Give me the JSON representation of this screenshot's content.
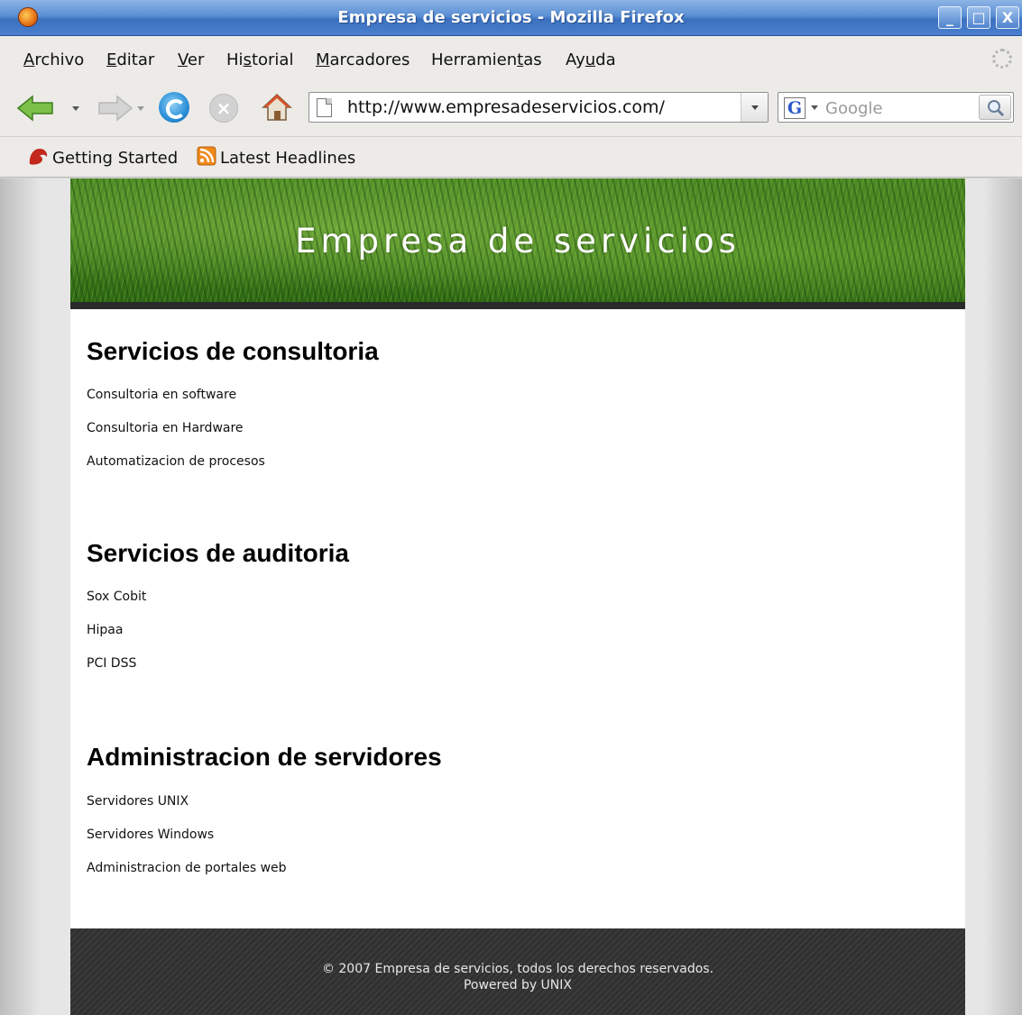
{
  "window": {
    "title": "Empresa de servicios - Mozilla Firefox",
    "buttons": {
      "minimize": "_",
      "maximize": "□",
      "close": "X"
    }
  },
  "menu": {
    "archivo": {
      "accel": "A",
      "rest": "rchivo"
    },
    "editar": {
      "accel": "E",
      "rest": "ditar"
    },
    "ver": {
      "accel": "V",
      "rest": "er"
    },
    "historial": {
      "pre": "Hi",
      "accel": "s",
      "rest": "torial"
    },
    "marcadores": {
      "accel": "M",
      "rest": "arcadores"
    },
    "herramientas": {
      "pre": "Herramien",
      "accel": "t",
      "rest": "as"
    },
    "ayuda": {
      "pre": "Ay",
      "accel": "u",
      "rest": "da"
    }
  },
  "toolbar": {
    "url": "http://www.empresadeservicios.com/",
    "search_placeholder": "Google",
    "search_engine_letter": "G",
    "stop_glyph": "×"
  },
  "bookmarks": {
    "getting_started": "Getting Started",
    "latest_headlines": "Latest Headlines"
  },
  "page": {
    "site_title": "Empresa de servicios",
    "sections": [
      {
        "heading": "Servicios de consultoria",
        "items": [
          "Consultoria en software",
          "Consultoria en Hardware",
          "Automatizacion de procesos"
        ]
      },
      {
        "heading": "Servicios de auditoria",
        "items": [
          "Sox Cobit",
          "Hipaa",
          "PCI DSS"
        ]
      },
      {
        "heading": "Administracion de servidores",
        "items": [
          "Servidores UNIX",
          "Servidores Windows",
          "Administracion de portales web"
        ]
      }
    ],
    "footer": {
      "copyright": "© 2007 Empresa de servicios, todos los derechos reservados.",
      "powered": "Powered by UNIX"
    }
  },
  "colors": {
    "titlebar": "#3b70bf",
    "chrome": "#ecebe8",
    "header_green": "#4d8a25",
    "header_border": "#2a2a2a",
    "footer_bg": "#333333"
  }
}
